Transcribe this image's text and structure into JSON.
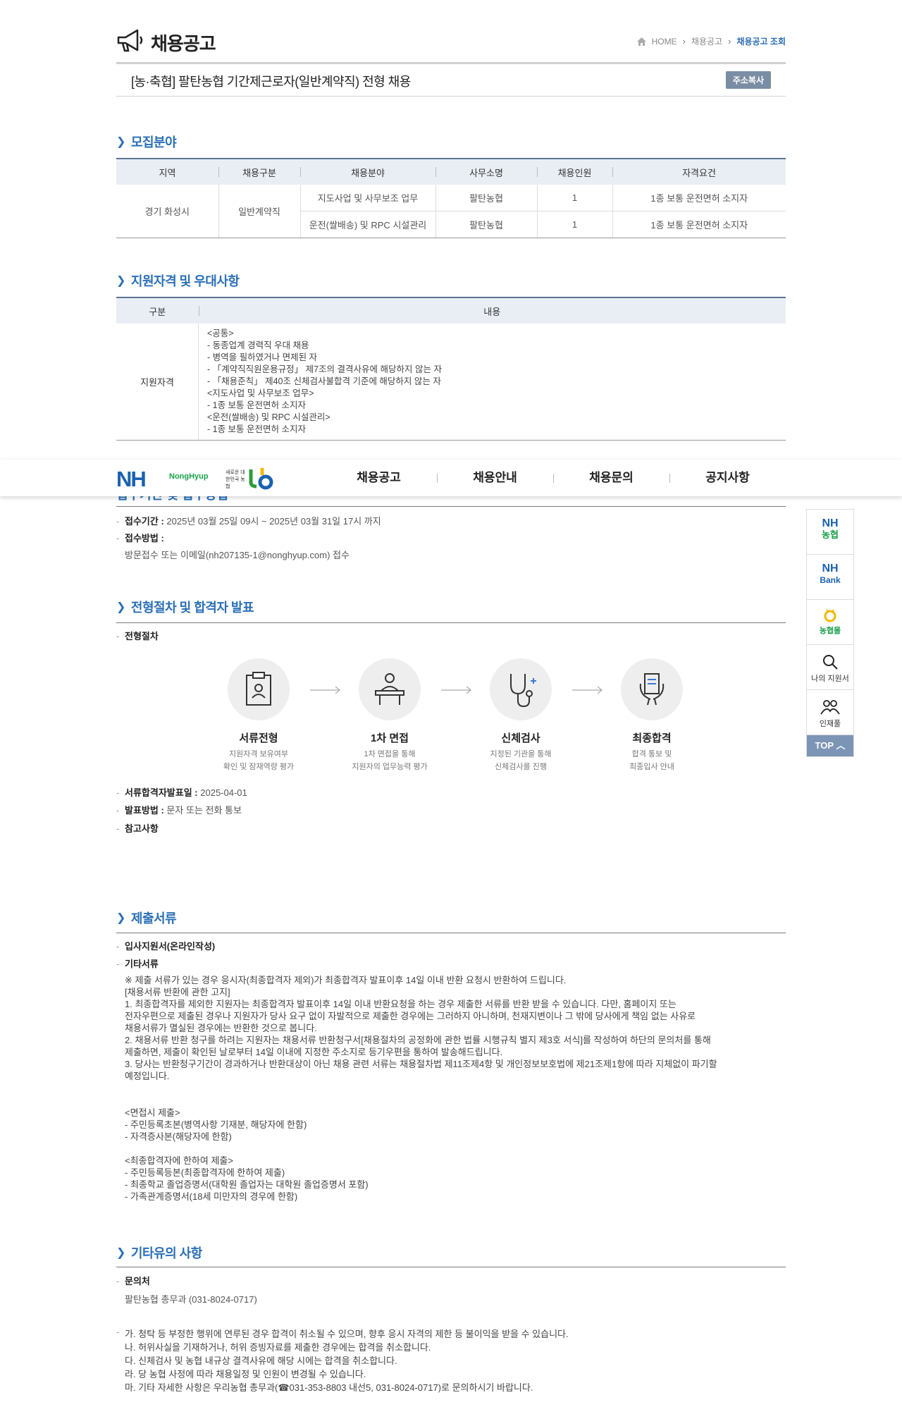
{
  "header": {
    "title": "채용공고",
    "breadcrumb": [
      "HOME",
      "채용공고",
      "채용공고 조회"
    ]
  },
  "posting": {
    "title": "[농·축협] 팔탄농협 기간제근로자(일반계약직) 전형 채용",
    "copy_button": "주소복사"
  },
  "recruit": {
    "section_title": "모집분야",
    "headers": [
      "지역",
      "채용구분",
      "채용분야",
      "사무소명",
      "채용인원",
      "자격요건"
    ],
    "region": "경기 화성시",
    "type": "일반계약직",
    "rows": [
      {
        "field": "지도사업 및 사무보조 업무",
        "office": "팔탄농협",
        "count": "1",
        "req": "1종 보통 운전면허 소지자"
      },
      {
        "field": "운전(쌀배송) 및 RPC 시설관리",
        "office": "팔탄농협",
        "count": "1",
        "req": "1종 보통 운전면허 소지자"
      }
    ]
  },
  "qual": {
    "section_title": "지원자격 및 우대사항",
    "headers": [
      "구분",
      "내용"
    ],
    "label": "지원자격",
    "lines": [
      "<공통>",
      "- 동종업계 경력직 우대 채용",
      "- 병역을 필하였거나 면제된 자",
      "- 「계약직직원운용규정」 제7조의 결격사유에 해당하지 않는 자",
      "- 「채용준칙」 제40조 신체검사불합격 기준에 해당하지 않는 자",
      "<지도사업 및 사무보조 업무>",
      "- 1종 보통 운전면허 소지자",
      "<운전(쌀배송) 및 RPC 시설관리>",
      "- 1종 보통 운전면허 소지자"
    ]
  },
  "nav": {
    "logo": "NH",
    "logo_sub": "NongHyup",
    "slogan": "새로운 대한민국 농협",
    "menu": [
      "채용공고",
      "채용안내",
      "채용문의",
      "공지사항"
    ]
  },
  "apply": {
    "section_title": "접수기간 및 접수방법",
    "period_label": "접수기간 :",
    "period": "2025년 03월 25일 09시 ~ 2025년 03월 31일 17시 까지",
    "method_label": "접수방법 :",
    "method": "방문접수 또는 이메일(nh207135-1@nonghyup.com) 접수"
  },
  "process": {
    "section_title": "전형절차 및 합격자 발표",
    "label": "전형절차",
    "steps": [
      {
        "name": "서류전형",
        "d1": "지원자격 보유여부",
        "d2": "확인 및 잠재역량 평가",
        "icon": "clipboard-icon"
      },
      {
        "name": "1차 면접",
        "d1": "1차 면접을 통해",
        "d2": "지원자의 업무능력 평가",
        "icon": "interview-icon"
      },
      {
        "name": "신체검사",
        "d1": "지정된 기관을 통해",
        "d2": "신체검사를 진행",
        "icon": "stethoscope-icon"
      },
      {
        "name": "최종합격",
        "d1": "합격 통보 및",
        "d2": "최종입사 안내",
        "icon": "certificate-icon"
      }
    ],
    "result_label": "서류합격자발표일 :",
    "result_date": "2025-04-01",
    "announce_label": "발표방법 :",
    "announce": "문자 또는 전화 통보",
    "note_label": "참고사항"
  },
  "docs": {
    "section_title": "제출서류",
    "item1": "입사지원서(온라인작성)",
    "item2": "기타서류",
    "text1": "※ 제출 서류가 있는 경우 응시자(최종합격자 제외)가 최종합격자 발표이후 14일 이내 반환 요청시 반환하여 드립니다.\n[채용서류 반환에 관한 고지]\n 1. 최종합격자를 제외한 지원자는 최종합격자 발표이후 14일 이내 반환요청을 하는 경우 제출한 서류를 반환 받을 수 있습니다. 다만, 홈페이지 또는\n전자우편으로 제출된 경우나 지원자가 당사 요구 없이 자발적으로 제출한 경우에는 그러하지 아니하며, 천재지변이나 그 밖에 당사에게 책임 없는 사유로\n채용서류가 멸실된 경우에는 반환한 것으로 봅니다.\n 2. 채용서류 반환 청구를 하려는 지원자는 채용서류 반환청구서[채용절차의 공정화에 관한 법률 시행규칙 별지 제3호 서식]를 작성하여 하단의 문의처를 통해\n제출하면, 제출이 확인된 날로부터 14일 이내에 지정한 주소지로 등기우편을 통하여 발송해드립니다.\n 3. 당사는 반환청구기간이 경과하거나 반환대상이 아닌 채용 관련 서류는 채용절차법 제11조제4항 및 개인정보보호법에 제21조제1항에 따라 지체없이 파기할\n예정입니다.",
    "text2": " <면접시 제출>\n- 주민등록초본(병역사항 기재분, 해당자에 한함)\n- 자격증사본(해당자에 한함)\n\n <최종합격자에 한하여 제출>\n- 주민등록등본(최종합격자에 한하여 제출)\n- 최종학교 졸업증명서(대학원 졸업자는 대학원 졸업증명서 포함)\n- 가족관계증명서(18세 미만자의 경우에 한함)"
  },
  "etc": {
    "section_title": "기타유의 사항",
    "contact_label": "문의처",
    "contact": "팔탄농협 총무과 (031-8024-0717)",
    "notes": "가. 청탁 등 부정한 행위에 연루된 경우 합격이 취소될 수 있으며, 향후 응시 자격의 제한 등 불이익을 받을 수 있습니다.\n 나. 허위사실을 기재하거나, 허위 증빙자료를 제출한 경우에는 합격을 취소합니다.\n 다. 신체검사 및 농협 내규상 결격사유에 해당 시에는 합격을 취소합니다.\n 라. 당 농협 사정에 따라 채용일정 및 인원이 변경될 수 있습니다.\n 마. 기타 자세한 사항은 우리농협 총무과(☎031-353-8803 내선5, 031-8024-0717)로 문의하시기 바랍니다."
  },
  "quick": {
    "nh_nonghyup_top": "NH",
    "nh_nonghyup_bottom": "농협",
    "nh_bank_top": "NH",
    "nh_bank_bottom": "Bank",
    "mall": "농협몰",
    "my_apply": "나의 지원서",
    "talent": "인재풀",
    "top": "TOP"
  },
  "colors": {
    "accent": "#2a6fb6",
    "table_head": "#e9eef5",
    "nh_blue": "#1a62b0",
    "quick_top": "#7c95b6"
  }
}
